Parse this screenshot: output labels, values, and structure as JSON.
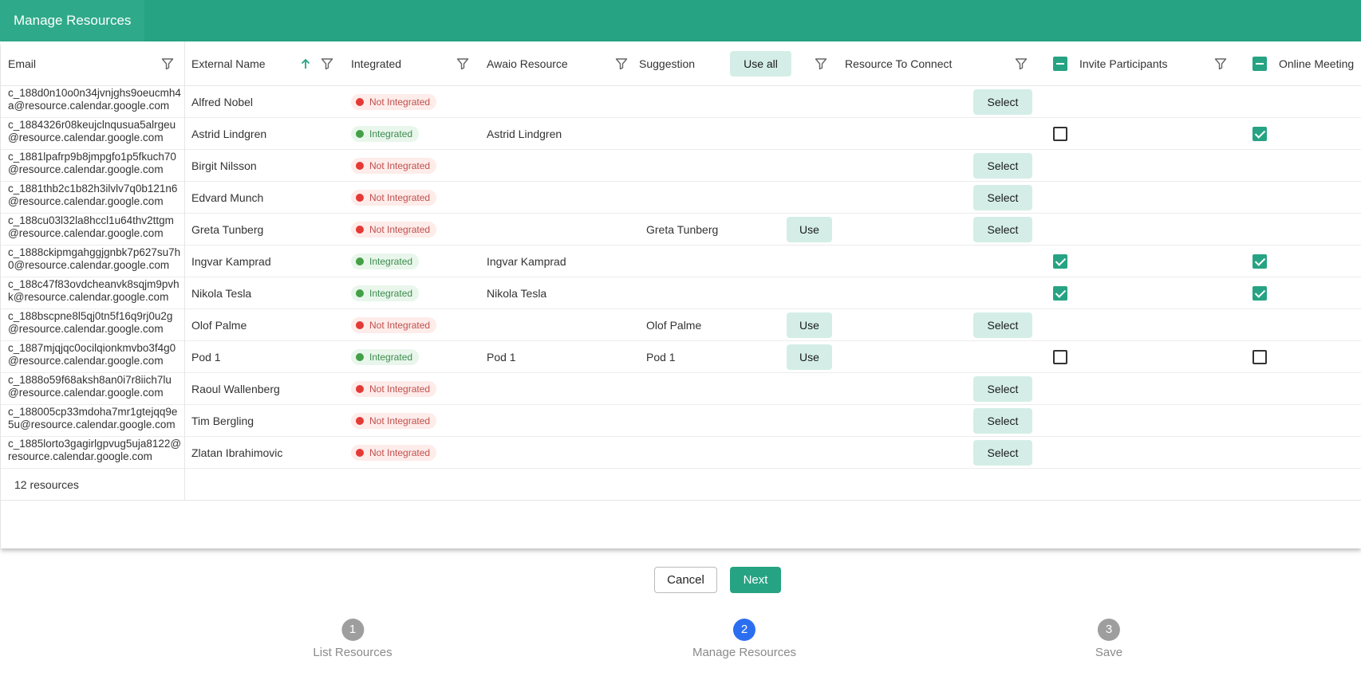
{
  "dialog": {
    "title": "Manage Resources"
  },
  "columns": {
    "email": "Email",
    "external_name": "External Name",
    "integrated": "Integrated",
    "awaio_resource": "Awaio Resource",
    "suggestion": "Suggestion",
    "use_all": "Use all",
    "resource_to_connect": "Resource To Connect",
    "invite_participants": "Invite Participants",
    "online_meeting": "Online Meeting"
  },
  "labels": {
    "not_integrated": "Not Integrated",
    "integrated": "Integrated",
    "select": "Select",
    "use": "Use"
  },
  "rows": [
    {
      "email": "c_188d0n10o0n34jvnjghs9oeucmh4a@resource.calendar.google.com",
      "name": "Alfred Nobel",
      "integrated": false,
      "awaio": "",
      "suggestion": "",
      "use": false,
      "select": true,
      "invite": null,
      "online": null
    },
    {
      "email": "c_1884326r08keujclnqusua5alrgeu@resource.calendar.google.com",
      "name": "Astrid Lindgren",
      "integrated": true,
      "awaio": "Astrid Lindgren",
      "suggestion": "",
      "use": false,
      "select": false,
      "invite": false,
      "online": true
    },
    {
      "email": "c_1881lpafrp9b8jmpgfo1p5fkuch70@resource.calendar.google.com",
      "name": "Birgit Nilsson",
      "integrated": false,
      "awaio": "",
      "suggestion": "",
      "use": false,
      "select": true,
      "invite": null,
      "online": null
    },
    {
      "email": "c_1881thb2c1b82h3ilvlv7q0b121n6@resource.calendar.google.com",
      "name": "Edvard Munch",
      "integrated": false,
      "awaio": "",
      "suggestion": "",
      "use": false,
      "select": true,
      "invite": null,
      "online": null
    },
    {
      "email": "c_188cu03l32la8hccl1u64thv2ttgm@resource.calendar.google.com",
      "name": "Greta Tunberg",
      "integrated": false,
      "awaio": "",
      "suggestion": "Greta Tunberg",
      "use": true,
      "select": true,
      "invite": null,
      "online": null
    },
    {
      "email": "c_1888ckipmgahggjgnbk7p627su7h0@resource.calendar.google.com",
      "name": "Ingvar Kamprad",
      "integrated": true,
      "awaio": "Ingvar Kamprad",
      "suggestion": "",
      "use": false,
      "select": false,
      "invite": true,
      "online": true
    },
    {
      "email": "c_188c47f83ovdcheanvk8sqjm9pvhk@resource.calendar.google.com",
      "name": "Nikola Tesla",
      "integrated": true,
      "awaio": "Nikola Tesla",
      "suggestion": "",
      "use": false,
      "select": false,
      "invite": true,
      "online": true
    },
    {
      "email": "c_188bscpne8l5qj0tn5f16q9rj0u2g@resource.calendar.google.com",
      "name": "Olof Palme",
      "integrated": false,
      "awaio": "",
      "suggestion": "Olof Palme",
      "use": true,
      "select": true,
      "invite": null,
      "online": null
    },
    {
      "email": "c_1887mjqjqc0ocilqionkmvbo3f4g0@resource.calendar.google.com",
      "name": "Pod 1",
      "integrated": true,
      "awaio": "Pod 1",
      "suggestion": "Pod 1",
      "use": true,
      "select": false,
      "invite": false,
      "online": false
    },
    {
      "email": "c_1888o59f68aksh8an0i7r8iich7lu@resource.calendar.google.com",
      "name": "Raoul Wallenberg",
      "integrated": false,
      "awaio": "",
      "suggestion": "",
      "use": false,
      "select": true,
      "invite": null,
      "online": null
    },
    {
      "email": "c_188005cp33mdoha7mr1gtejqq9e5u@resource.calendar.google.com",
      "name": "Tim Bergling",
      "integrated": false,
      "awaio": "",
      "suggestion": "",
      "use": false,
      "select": true,
      "invite": null,
      "online": null
    },
    {
      "email": "c_1885lorto3gagirlgpvug5uja8122@resource.calendar.google.com",
      "name": "Zlatan Ibrahimovic",
      "integrated": false,
      "awaio": "",
      "suggestion": "",
      "use": false,
      "select": true,
      "invite": null,
      "online": null
    }
  ],
  "footer": {
    "count": "12 resources"
  },
  "actions": {
    "cancel": "Cancel",
    "next": "Next"
  },
  "steps": [
    {
      "number": "1",
      "label": "List Resources",
      "active": false
    },
    {
      "number": "2",
      "label": "Manage Resources",
      "active": true
    },
    {
      "number": "3",
      "label": "Save",
      "active": false
    }
  ],
  "colors": {
    "brand": "#26a383",
    "step_active": "#2b6ff0",
    "error": "#e53935",
    "success": "#43a047"
  }
}
